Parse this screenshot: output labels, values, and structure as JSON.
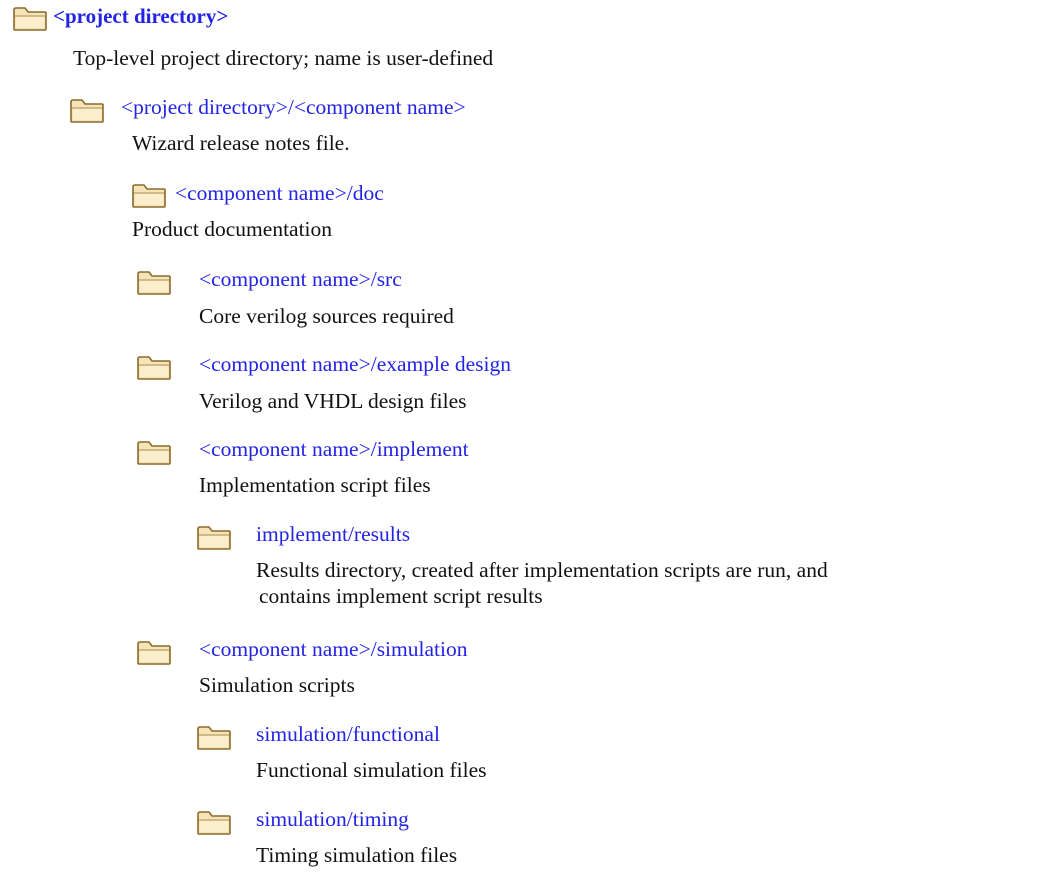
{
  "icons": {
    "folder": "folder-icon"
  },
  "colors": {
    "link": "#2323e6",
    "text": "#111111",
    "folder_fill": "#f6e4b8",
    "folder_stroke": "#8a6a2a"
  },
  "entries": [
    {
      "name": "<project directory>",
      "description": [
        "Top-level project directory; name is user-defined"
      ]
    },
    {
      "name": "<project directory>/<component name>",
      "description": [
        "Wizard release notes file."
      ]
    },
    {
      "name": "<component name>/doc",
      "description": [
        "Product documentation"
      ]
    },
    {
      "name": "<component name>/src",
      "description": [
        "Core verilog sources required"
      ]
    },
    {
      "name": "<component name>/example design",
      "description": [
        "Verilog and VHDL design files"
      ]
    },
    {
      "name": "<component name>/implement",
      "description": [
        "Implementation script files"
      ]
    },
    {
      "name": "implement/results",
      "description": [
        "Results directory, created after implementation scripts are run, and",
        "contains implement script results"
      ]
    },
    {
      "name": "<component name>/simulation",
      "description": [
        "Simulation scripts"
      ]
    },
    {
      "name": "simulation/functional",
      "description": [
        "Functional simulation files"
      ]
    },
    {
      "name": "simulation/timing",
      "description": [
        "Timing simulation files"
      ]
    }
  ]
}
